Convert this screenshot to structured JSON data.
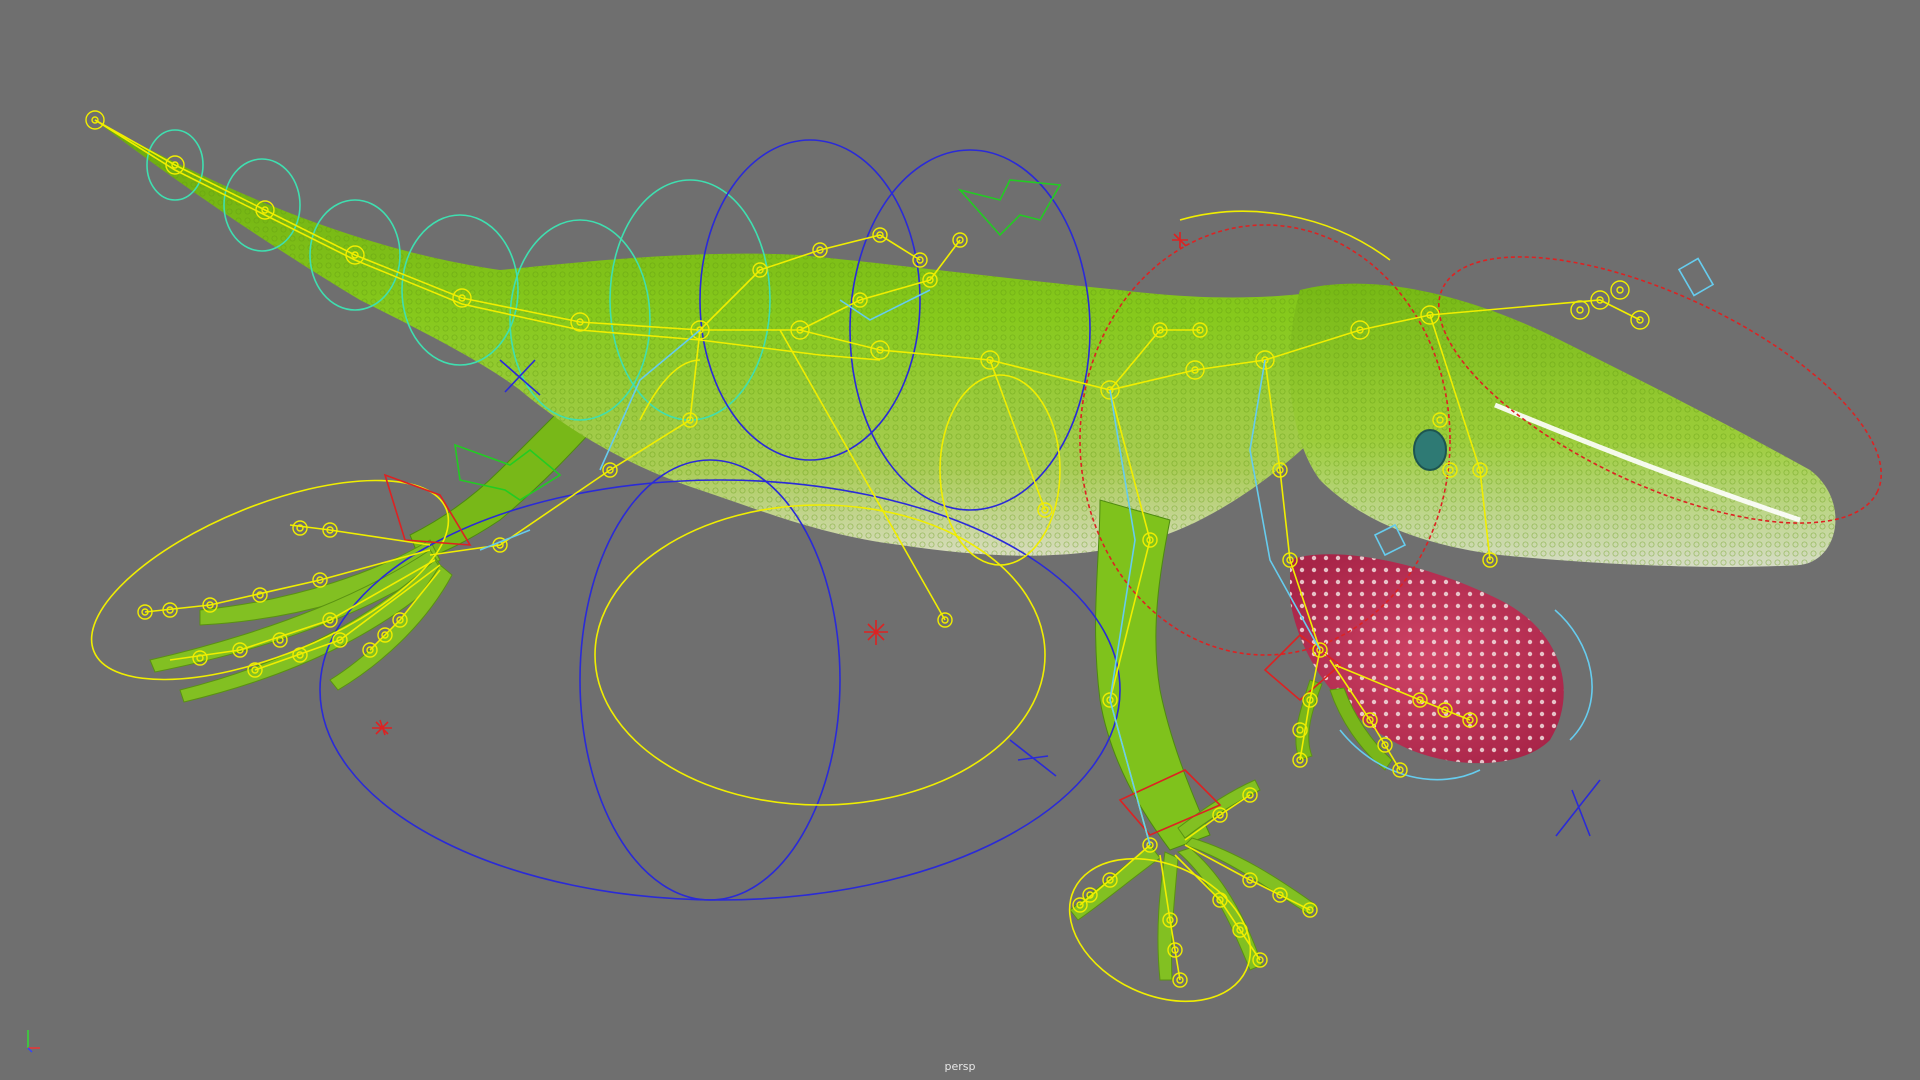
{
  "viewport": {
    "camera_name": "persp",
    "background_color": "#6f6f6f"
  },
  "colors": {
    "rig_yellow": "#f0ee00",
    "rig_cyan": "#66ccee",
    "rig_blue": "#2a2ad8",
    "rig_green": "#22cc22",
    "rig_red": "#dd2222",
    "rig_teal": "#44ddaa",
    "skin_green": "#7ec11a",
    "skin_dark": "#4e8c0e",
    "skin_belly": "#d9dcc2",
    "dewlap": "#c8385a"
  },
  "icons": [
    "axis-gizmo-icon",
    "locator-icon"
  ]
}
